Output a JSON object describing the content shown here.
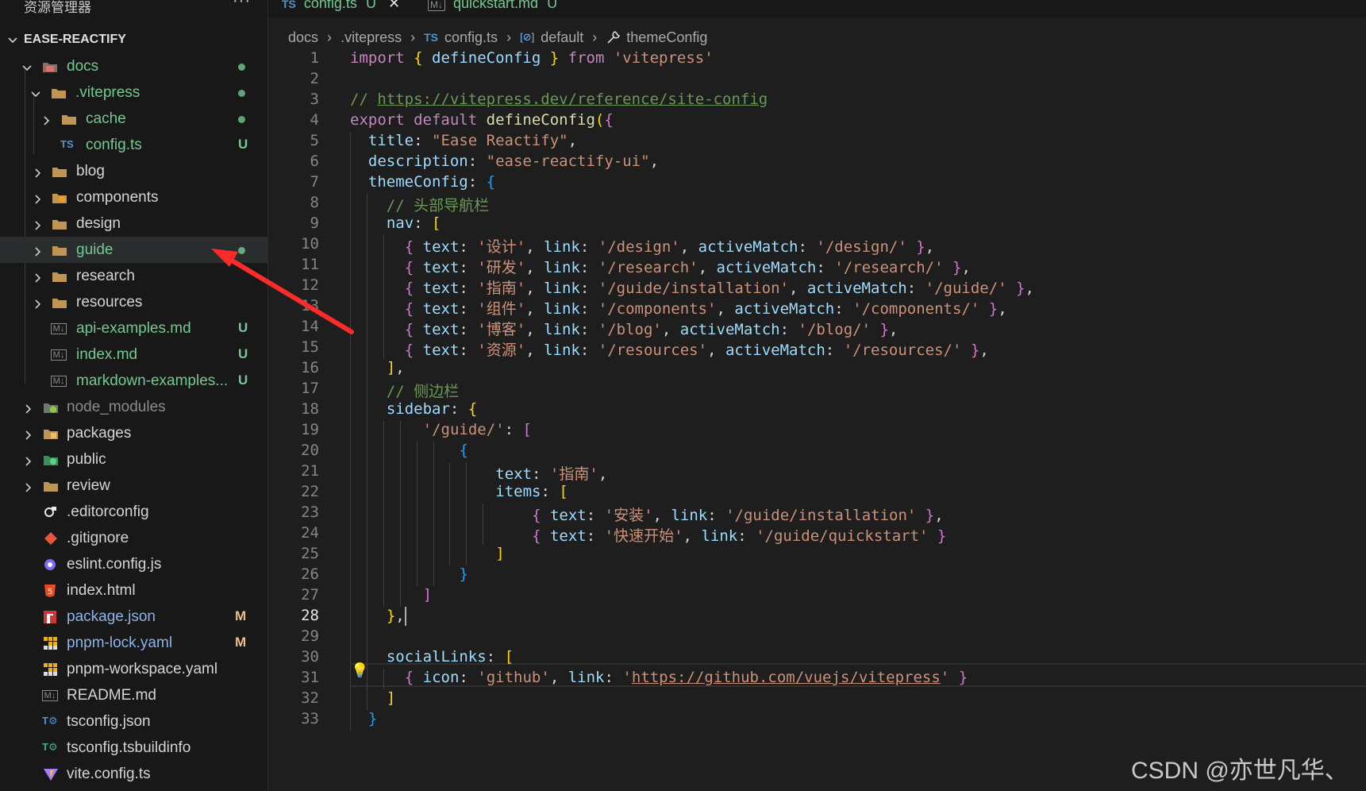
{
  "explorer": {
    "title": "资源管理器",
    "more_label": "···",
    "root": "EASE-REACTIFY",
    "items": [
      {
        "label": "docs",
        "badge": "",
        "dot": true
      },
      {
        "label": ".vitepress",
        "badge": "",
        "dot": true
      },
      {
        "label": "cache",
        "badge": "",
        "dot": true
      },
      {
        "label": "config.ts",
        "badge": "U",
        "dot": false
      },
      {
        "label": "blog",
        "badge": "",
        "dot": false
      },
      {
        "label": "components",
        "badge": "",
        "dot": false
      },
      {
        "label": "design",
        "badge": "",
        "dot": false
      },
      {
        "label": "guide",
        "badge": "",
        "dot": true
      },
      {
        "label": "research",
        "badge": "",
        "dot": false
      },
      {
        "label": "resources",
        "badge": "",
        "dot": false
      },
      {
        "label": "api-examples.md",
        "badge": "U",
        "dot": false
      },
      {
        "label": "index.md",
        "badge": "U",
        "dot": false
      },
      {
        "label": "markdown-examples...",
        "badge": "U",
        "dot": false
      },
      {
        "label": "node_modules",
        "badge": "",
        "dot": false
      },
      {
        "label": "packages",
        "badge": "",
        "dot": false
      },
      {
        "label": "public",
        "badge": "",
        "dot": false
      },
      {
        "label": "review",
        "badge": "",
        "dot": false
      },
      {
        "label": ".editorconfig",
        "badge": "",
        "dot": false
      },
      {
        "label": ".gitignore",
        "badge": "",
        "dot": false
      },
      {
        "label": "eslint.config.js",
        "badge": "",
        "dot": false
      },
      {
        "label": "index.html",
        "badge": "",
        "dot": false
      },
      {
        "label": "package.json",
        "badge": "M",
        "dot": false
      },
      {
        "label": "pnpm-lock.yaml",
        "badge": "M",
        "dot": false
      },
      {
        "label": "pnpm-workspace.yaml",
        "badge": "",
        "dot": false
      },
      {
        "label": "README.md",
        "badge": "",
        "dot": false
      },
      {
        "label": "tsconfig.json",
        "badge": "",
        "dot": false
      },
      {
        "label": "tsconfig.tsbuildinfo",
        "badge": "",
        "dot": false
      },
      {
        "label": "vite.config.ts",
        "badge": "",
        "dot": false
      }
    ]
  },
  "tabs": [
    {
      "icon": "TS",
      "label": "config.ts",
      "status": "U",
      "close": "✕"
    },
    {
      "icon": "M↓",
      "label": "quickstart.md",
      "status": "U"
    }
  ],
  "breadcrumb": {
    "parts": [
      "docs",
      ".vitepress",
      "config.ts",
      "default",
      "themeConfig"
    ],
    "ts_icon": "TS",
    "default_icon": "[⊘]",
    "sep": "›"
  },
  "editor": {
    "active_line": 28,
    "lines": [
      {
        "n": 1,
        "t": "import { defineConfig } from 'vitepress'"
      },
      {
        "n": 2,
        "t": ""
      },
      {
        "n": 3,
        "t": "// https://vitepress.dev/reference/site-config"
      },
      {
        "n": 4,
        "t": "export default defineConfig({"
      },
      {
        "n": 5,
        "t": "  title: \"Ease Reactify\","
      },
      {
        "n": 6,
        "t": "  description: \"ease-reactify-ui\","
      },
      {
        "n": 7,
        "t": "  themeConfig: {"
      },
      {
        "n": 8,
        "t": "    // 头部导航栏"
      },
      {
        "n": 9,
        "t": "    nav: ["
      },
      {
        "n": 10,
        "t": "      { text: '设计', link: '/design', activeMatch: '/design/' },"
      },
      {
        "n": 11,
        "t": "      { text: '研发', link: '/research', activeMatch: '/research/' },"
      },
      {
        "n": 12,
        "t": "      { text: '指南', link: '/guide/installation', activeMatch: '/guide/' },"
      },
      {
        "n": 13,
        "t": "      { text: '组件', link: '/components', activeMatch: '/components/' },"
      },
      {
        "n": 14,
        "t": "      { text: '博客', link: '/blog', activeMatch: '/blog/' },"
      },
      {
        "n": 15,
        "t": "      { text: '资源', link: '/resources', activeMatch: '/resources/' },"
      },
      {
        "n": 16,
        "t": "    ],"
      },
      {
        "n": 17,
        "t": "    // 侧边栏"
      },
      {
        "n": 18,
        "t": "    sidebar: {"
      },
      {
        "n": 19,
        "t": "        '/guide/': ["
      },
      {
        "n": 20,
        "t": "            {"
      },
      {
        "n": 21,
        "t": "                text: '指南',"
      },
      {
        "n": 22,
        "t": "                items: ["
      },
      {
        "n": 23,
        "t": "                    { text: '安装', link: '/guide/installation' },"
      },
      {
        "n": 24,
        "t": "                    { text: '快速开始', link: '/guide/quickstart' }"
      },
      {
        "n": 25,
        "t": "                ]"
      },
      {
        "n": 26,
        "t": "            }"
      },
      {
        "n": 27,
        "t": "        ]"
      },
      {
        "n": 28,
        "t": "    },"
      },
      {
        "n": 29,
        "t": ""
      },
      {
        "n": 30,
        "t": "    socialLinks: ["
      },
      {
        "n": 31,
        "t": "      { icon: 'github', link: 'https://github.com/vuejs/vitepress' }"
      },
      {
        "n": 32,
        "t": "    ]"
      },
      {
        "n": 33,
        "t": "  }"
      }
    ]
  },
  "colors": {
    "git_untracked": "#73c991",
    "git_modified": "#e2c08d",
    "annotation_arrow": "#ff2a2a"
  },
  "watermark": "CSDN @亦世凡华、"
}
